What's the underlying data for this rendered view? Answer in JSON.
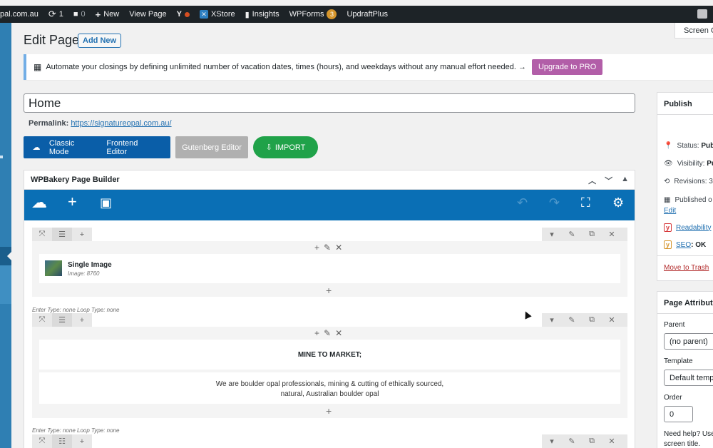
{
  "admin_bar": {
    "site": "pal.com.au",
    "updates": "1",
    "comments": "0",
    "new": "New",
    "view_page": "View Page",
    "xstore": "XStore",
    "insights": "Insights",
    "wpforms": "WPForms",
    "wpforms_count": "3",
    "updraft": "UpdraftPlus"
  },
  "screen_options": "Screen O",
  "page": {
    "title": "Edit Page",
    "add_new": "Add New"
  },
  "notice": {
    "text": "Automate your closings by defining unlimited number of vacation dates, times (hours), and weekdays without any manual effort needed. →",
    "button": "Upgrade to PRO"
  },
  "editor": {
    "post_title": "Home",
    "permalink_label": "Permalink:",
    "permalink_url": "https://signatureopal.com.au/",
    "classic_mode": "Classic Mode",
    "frontend_editor": "Frontend Editor",
    "gutenberg_editor": "Gutenberg Editor",
    "import": "IMPORT"
  },
  "wpbakery": {
    "title": "WPBakery Page Builder",
    "rows": [
      {
        "element_title": "Single Image",
        "element_sub": "Image: 8760"
      },
      {
        "meta": "Enter Type: none  Loop Type: none",
        "heading": "MINE TO MARKET;",
        "text_line1": "We are boulder opal professionals, mining & cutting of ethically sourced,",
        "text_line2": "natural, Australian boulder opal"
      },
      {
        "meta": "Enter Type: none  Loop Type: none"
      }
    ]
  },
  "publish": {
    "title": "Publish",
    "status_label": "Status:",
    "status_value": "Pub",
    "visibility_label": "Visibility:",
    "visibility_value": "Pu",
    "revisions": "Revisions: 3",
    "published_on": "Published o",
    "edit": "Edit",
    "readability": "Readability",
    "seo": "SEO",
    "seo_value": ": OK",
    "trash": "Move to Trash"
  },
  "attributes": {
    "title": "Page Attribute",
    "parent_label": "Parent",
    "parent_value": "(no parent)",
    "template_label": "Template",
    "template_value": "Default temp",
    "order_label": "Order",
    "order_value": "0",
    "help_line1": "Need help? Use",
    "help_line2": "screen title."
  }
}
